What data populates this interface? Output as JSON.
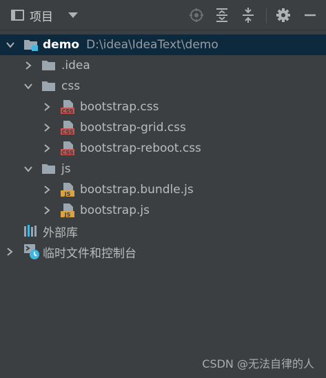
{
  "toolbar": {
    "title": "项目"
  },
  "tree": {
    "root": {
      "name": "demo",
      "path": "D:\\idea\\IdeaText\\demo"
    },
    "nodes": [
      {
        "label": ".idea"
      },
      {
        "label": "css"
      },
      {
        "label": "bootstrap.css",
        "badge": "CSS"
      },
      {
        "label": "bootstrap-grid.css",
        "badge": "CSS"
      },
      {
        "label": "bootstrap-reboot.css",
        "badge": "CSS"
      },
      {
        "label": "js"
      },
      {
        "label": "bootstrap.bundle.js",
        "badge": "JS"
      },
      {
        "label": "bootstrap.js",
        "badge": "JS"
      },
      {
        "label": "外部库"
      },
      {
        "label": "临时文件和控制台"
      }
    ]
  },
  "watermark": "CSDN @无法自律的人",
  "colors": {
    "selection": "#0d293e",
    "folder": "#9aa7b0",
    "css_badge": "#c75450",
    "js_badge": "#d9a343",
    "module_square": "#40b6e0"
  }
}
